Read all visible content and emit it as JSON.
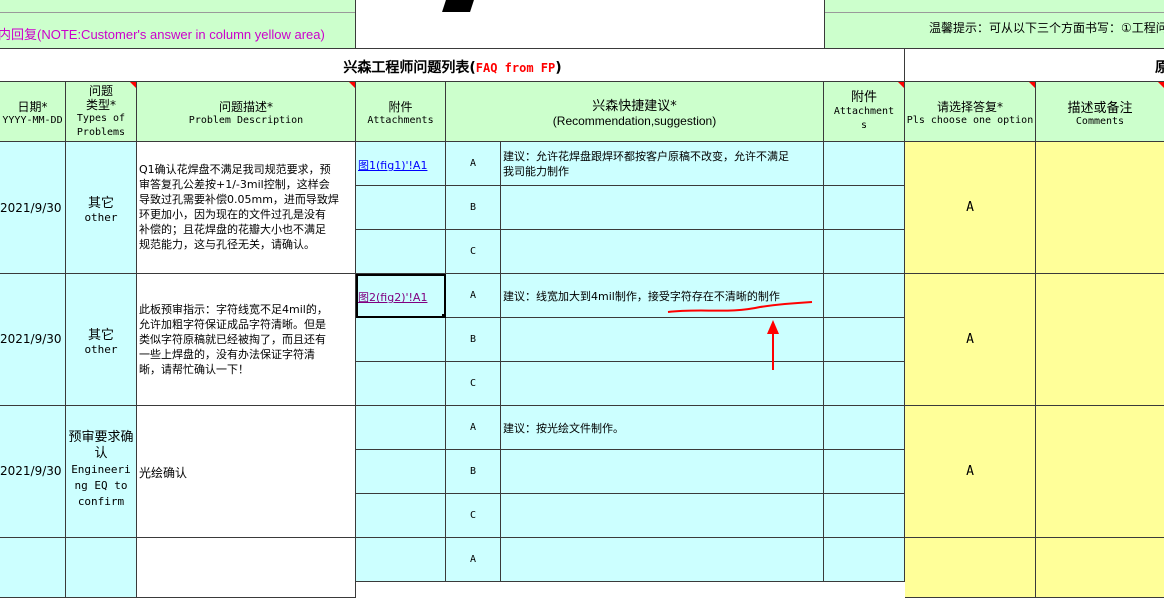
{
  "top": {
    "note": "内回复(NOTE:Customer's answer in column yellow area)",
    "tip": "温馨提示：可从以下三个方面书写：①工程问"
  },
  "title": {
    "cn": "兴森工程师问题列表",
    "en": "FAQ from FP",
    "right_partial": "原"
  },
  "headers": {
    "date_cn": "日期*",
    "date_fmt": "YYYY-MM-DD",
    "type_cn1": "问题",
    "type_cn2": "类型*",
    "type_en1": "Types of",
    "type_en2": "Problems",
    "desc_cn": "问题描述*",
    "desc_en": "Problem Description",
    "att_cn": "附件",
    "att_en": "Attachments",
    "rec_cn": "兴森快捷建议*",
    "rec_en": "(Recommendation,suggestion)",
    "att2_cn": "附件",
    "att2_en1": "Attachment",
    "att2_en2": "s",
    "reply_cn": "请选择答复*",
    "reply_en": "Pls choose one option",
    "comment_cn": "描述或备注",
    "comment_en": "Comments"
  },
  "rows": [
    {
      "date": "2021/9/30",
      "type_cn": "其它",
      "type_en": "other",
      "desc": [
        "Q1确认花焊盘不满足我司规范要求，预",
        "审答复孔公差按+1/-3mil控制，这样会",
        "导致过孔需要补偿0.05mm，进而导致焊",
        "环更加小，因为现在的文件过孔是没有",
        "补偿的；且花焊盘的花瓣大小也不满足",
        "规范能力，这与孔径无关，请确认。"
      ],
      "attachment": "图1(fig1)'!A1",
      "options": [
        "A",
        "B",
        "C"
      ],
      "suggestions": [
        [
          "建议：允许花焊盘跟焊环都按客户原稿不改变，允许不满足",
          "我司能力制作"
        ],
        [],
        []
      ],
      "reply": "A"
    },
    {
      "date": "2021/9/30",
      "type_cn": "其它",
      "type_en": "other",
      "desc": [
        "此板预审指示：字符线宽不足4mil的，",
        "允许加粗字符保证成品字符清晰。但是",
        "类似字符原稿就已经被掏了，而且还有",
        "一些上焊盘的，没有办法保证字符清",
        "晰，请帮忙确认一下！"
      ],
      "attachment": "图2(fig2)'!A1",
      "options": [
        "A",
        "B",
        "C"
      ],
      "suggestions": [
        [
          "建议：线宽加大到4mil制作，接受字符存在不清晰的制作"
        ],
        [],
        []
      ],
      "reply": "A"
    },
    {
      "date": "2021/9/30",
      "type_cn": "预审要求确认",
      "type_en": "Engineering EQ to confirm",
      "desc": [
        "光绘确认"
      ],
      "attachment": "",
      "options": [
        "A",
        "B",
        "C"
      ],
      "suggestions": [
        [
          "建议：按光绘文件制作。"
        ],
        [],
        []
      ],
      "reply": "A"
    },
    {
      "date": "",
      "type_cn": "",
      "type_en": "",
      "desc": [],
      "attachment": "",
      "options": [
        "A"
      ],
      "suggestions": [
        []
      ],
      "reply": ""
    }
  ],
  "colors": {
    "header_green": "#ccffcc",
    "row_cyan": "#ccffff",
    "answer_yellow": "#ffff99",
    "note_magenta": "#cc00cc",
    "annotation_red": "#ff0000"
  }
}
